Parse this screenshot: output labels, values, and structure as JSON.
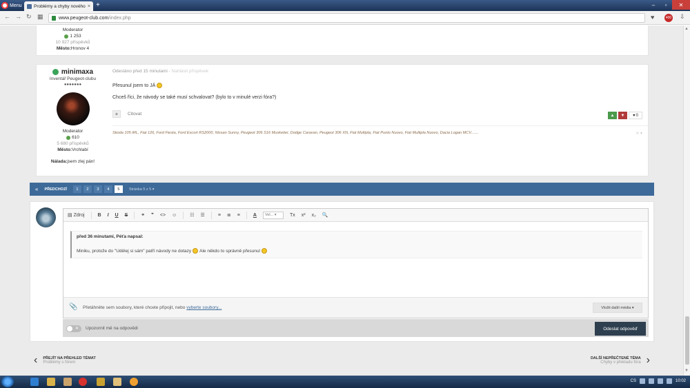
{
  "browser": {
    "menu_label": "Menu",
    "tab_title": "Problémy a chyby nového",
    "url_host": "www.peugeot-club.com",
    "url_path": "/index.php",
    "ext_badge": "400"
  },
  "post1": {
    "role": "Moderator",
    "reputation": "1 253",
    "posts": "10 927 příspěvků",
    "city_label": "Město:",
    "city": "Hronov 4"
  },
  "post2": {
    "username": "minimaxa",
    "rank": "Inventář Peugeot-clubu",
    "pips": "●●●●●●●",
    "role": "Moderator",
    "reputation": "610",
    "posts": "5 680 příspěvků",
    "city_label": "Město:",
    "city": "Vrchlabí",
    "mood_label": "Nálada:",
    "mood": "jsem zlej pán!",
    "meta_time": "Odesláno před 15 minutami",
    "meta_sep": " · ",
    "meta_report": "Nahlásit příspěvek",
    "line1": "Přesunul jsem to JÁ",
    "line2": "Chceš říci, že návody se také musí schvalovat? (bylo to v minulé verzi fóra?)",
    "quote_label": "Citovat",
    "vote_up": "▲",
    "vote_down": "▼",
    "vote_count": "0",
    "signature": "Škoda 105 tRL, Fiat 126, Ford Fiesta, Ford Escort RS2000, Nissan Sunny, Peugeot 306 S16 Musketier, Dodge Caravan, Peugeot 306 XN, Fiat Multipla, Fiat Punto Nuovo, Fiat Multipla Nuovo, Dacia Logan MCV.......",
    "sig_x": "✕ ▾"
  },
  "pagination": {
    "first": "«",
    "prev": "PŘEDCHOZÍ",
    "pages": [
      "1",
      "2",
      "3",
      "4",
      "5"
    ],
    "info": "Stránka 5 z 5 ▾"
  },
  "editor": {
    "toolbar": {
      "source": "Zdroj",
      "bold": "B",
      "italic": "I",
      "underline": "U",
      "strike": "S",
      "link": "⚭",
      "quote": "❞",
      "code": "<>",
      "emoji": "☺",
      "ul": "☷",
      "ol": "☰",
      "align_left": "≡",
      "align_center": "≣",
      "align_right": "≡",
      "color": "A",
      "font_size": "Vel... ▾",
      "clear": "Tx",
      "sup": "x²",
      "sub": "x₂",
      "preview": "🔍"
    },
    "quote_header": "před 36 minutami, Péťa napsal:",
    "quote_text_1": "Miniku, protože do \"Udělej si sám\" patří návody ne dotazy",
    "quote_text_2": "Ale někdo to správně přesunul",
    "attach_text": "Přetáhněte sem soubory, které chcete připojit, nebo",
    "attach_link": "vyberte soubory...",
    "more_media": "Vložit další média ▾",
    "notify": "Upozornit mě na odpovědi",
    "toggle_x": "✕",
    "submit": "Odeslat odpověď"
  },
  "bottom_nav": {
    "left_title": "PŘEJÍT NA PŘEHLED TÉMAT",
    "left_sub": "Problémy s fórem",
    "right_title": "DALŠÍ NEPŘEČTENÉ TÉMA",
    "right_sub": "Chyby v překladu fóra"
  },
  "taskbar": {
    "lang": "CS",
    "time": "10:02"
  }
}
